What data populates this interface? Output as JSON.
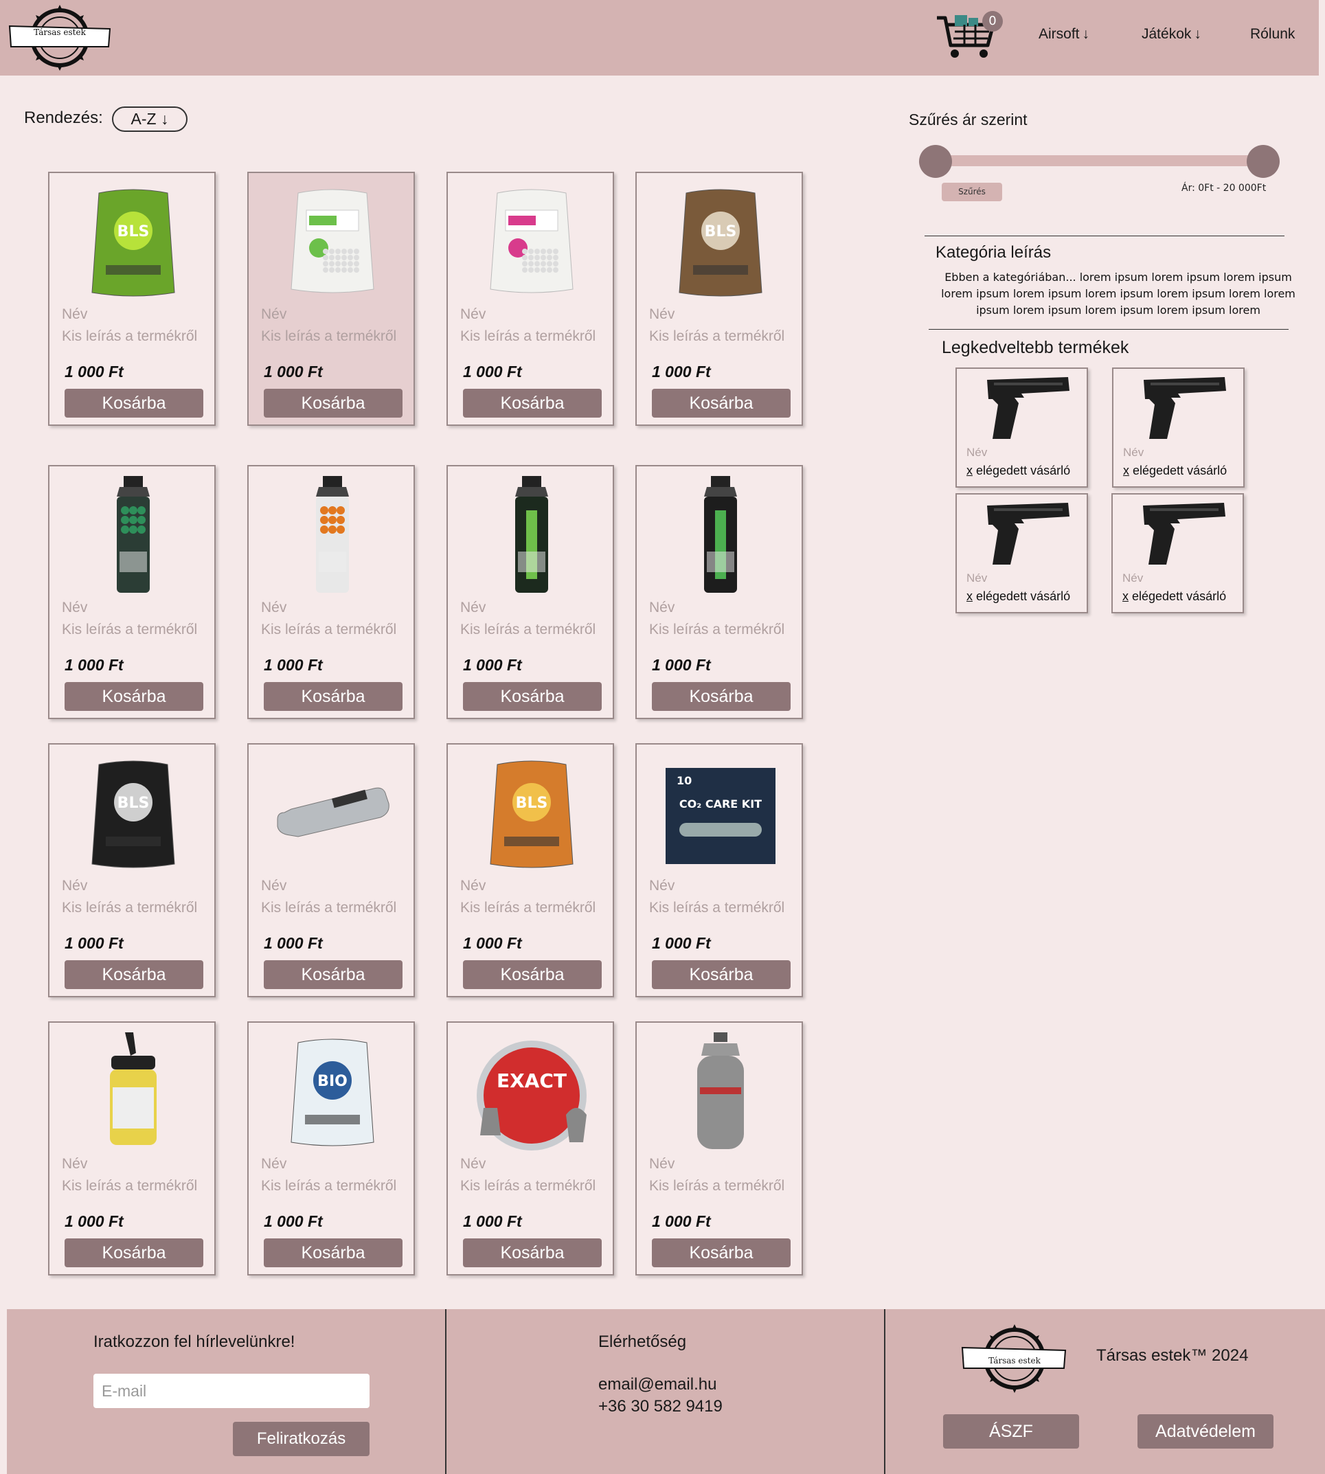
{
  "header": {
    "logo_text": "Társas estek",
    "cart_count": "0",
    "nav": [
      {
        "label": "Airsoft",
        "arrow": "↓"
      },
      {
        "label": "Játékok",
        "arrow": "↓"
      },
      {
        "label": "Rólunk",
        "arrow": ""
      }
    ]
  },
  "sort": {
    "label": "Rendezés:",
    "value": "A-Z ↓"
  },
  "products": [
    {
      "name": "Név",
      "desc": "Kis leírás a termékről",
      "price": "1 000 Ft",
      "button": "Kosárba",
      "icon": "bbs-bag-green-icon"
    },
    {
      "name": "Név",
      "desc": "Kis leírás a termékről",
      "price": "1 000 Ft",
      "button": "Kosárba",
      "icon": "bbs-bag-white-green-icon"
    },
    {
      "name": "Név",
      "desc": "Kis leírás a termékről",
      "price": "1 000 Ft",
      "button": "Kosárba",
      "icon": "bbs-bag-white-pink-icon"
    },
    {
      "name": "Név",
      "desc": "Kis leírás a termékről",
      "price": "1 000 Ft",
      "button": "Kosárba",
      "icon": "bbs-bag-brown-icon"
    },
    {
      "name": "Név",
      "desc": "Kis leírás a termékről",
      "price": "1 000 Ft",
      "button": "Kosárba",
      "icon": "gas-can-green-icon"
    },
    {
      "name": "Név",
      "desc": "Kis leírás a termékről",
      "price": "1 000 Ft",
      "button": "Kosárba",
      "icon": "gas-can-orange-icon"
    },
    {
      "name": "Név",
      "desc": "Kis leírás a termékről",
      "price": "1 000 Ft",
      "button": "Kosárba",
      "icon": "gas-can-protechgas-icon"
    },
    {
      "name": "Név",
      "desc": "Kis leírás a termékről",
      "price": "1 000 Ft",
      "button": "Kosárba",
      "icon": "gas-can-black-icon"
    },
    {
      "name": "Név",
      "desc": "Kis leírás a termékről",
      "price": "1 000 Ft",
      "button": "Kosárba",
      "icon": "bbs-bag-black-icon"
    },
    {
      "name": "Név",
      "desc": "Kis leírás a termékről",
      "price": "1 000 Ft",
      "button": "Kosárba",
      "icon": "co2-capsule-icon"
    },
    {
      "name": "Név",
      "desc": "Kis leírás a termékről",
      "price": "1 000 Ft",
      "button": "Kosárba",
      "icon": "bbs-bag-orange-icon"
    },
    {
      "name": "Név",
      "desc": "Kis leírás a termékről",
      "price": "1 000 Ft",
      "button": "Kosárba",
      "icon": "co2-care-kit-icon"
    },
    {
      "name": "Név",
      "desc": "Kis leírás a termékről",
      "price": "1 000 Ft",
      "button": "Kosárba",
      "icon": "bbs-bottle-icon"
    },
    {
      "name": "Név",
      "desc": "Kis leírás a termékről",
      "price": "1 000 Ft",
      "button": "Kosárba",
      "icon": "bbs-bag-bio-icon"
    },
    {
      "name": "Név",
      "desc": "Kis leírás a termékről",
      "price": "1 000 Ft",
      "button": "Kosárba",
      "icon": "pellet-tin-icon"
    },
    {
      "name": "Név",
      "desc": "Kis leírás a termékről",
      "price": "1 000 Ft",
      "button": "Kosárba",
      "icon": "gas-cylinder-icon"
    }
  ],
  "filter": {
    "title": "Szűrés ár szerint",
    "button": "Szűrés",
    "range": "Ár: 0Ft - 20 000Ft"
  },
  "category": {
    "title": "Kategória leírás",
    "description": "Ebben a kategóriában... lorem ipsum lorem ipsum lorem ipsum lorem ipsum lorem ipsum lorem ipsum lorem ipsum lorem lorem ipsum lorem ipsum lorem ipsum lorem ipsum lorem"
  },
  "popular": {
    "title": "Legkedveltebb termékek",
    "items": [
      {
        "name": "Név",
        "buyers_x": "x",
        "buyers_text": " elégedett vásárló"
      },
      {
        "name": "Név",
        "buyers_x": "x",
        "buyers_text": " elégedett vásárló"
      },
      {
        "name": "Név",
        "buyers_x": "x",
        "buyers_text": " elégedett vásárló"
      },
      {
        "name": "Név",
        "buyers_x": "x",
        "buyers_text": " elégedett vásárló"
      }
    ]
  },
  "footer": {
    "newsletter_title": "Iratkozzon fel hírlevelünkre!",
    "email_placeholder": "E-mail",
    "subscribe_button": "Feliratkozás",
    "contact_title": "Elérhetőség",
    "contact_email": "email@email.hu",
    "contact_phone": "+36 30 582 9419",
    "logo_text": "Társas estek",
    "copyright": "Társas estek™ 2024",
    "terms_button": "ÁSZF",
    "privacy_button": "Adatvédelem"
  },
  "colors": {
    "header_bg": "#d4b3b2",
    "page_bg": "#f5e9e9",
    "button_bg": "#8e7577"
  }
}
